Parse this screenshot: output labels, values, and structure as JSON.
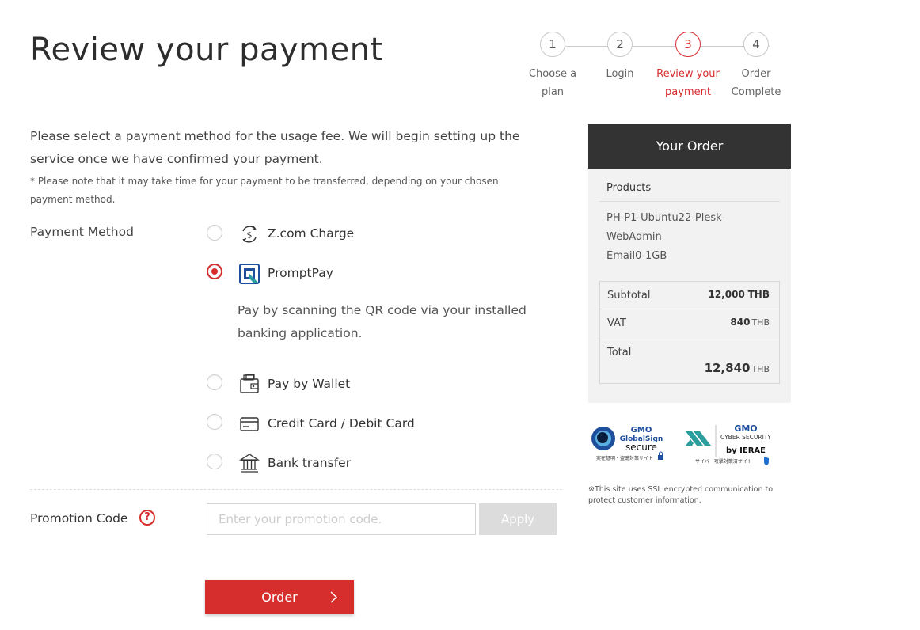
{
  "page": {
    "title": "Review your payment"
  },
  "stepper": {
    "steps": [
      {
        "number": "1",
        "label_line1": "Choose a",
        "label_line2": "plan"
      },
      {
        "number": "2",
        "label_line1": "Login",
        "label_line2": ""
      },
      {
        "number": "3",
        "label_line1": "Review your",
        "label_line2": "payment"
      },
      {
        "number": "4",
        "label_line1": "Order",
        "label_line2": "Complete"
      }
    ],
    "active_step": "3",
    "active_color": "#d62d2d"
  },
  "intro": {
    "text": "Please select a payment method for the usage fee. We will begin setting up the service once we have confirmed your payment.",
    "note": "* Please note that it may take time for your payment to be transferred, depending on your chosen payment method."
  },
  "payment": {
    "label": "Payment Method",
    "selected": "PromptPay",
    "methods": [
      {
        "name": "Z.com Charge",
        "icon": "zcom-charge-icon",
        "checked": false
      },
      {
        "name": "PromptPay",
        "icon": "promptpay-icon",
        "checked": true,
        "description": "Pay by scanning the QR code via your installed banking application."
      },
      {
        "name": "Pay by Wallet",
        "icon": "wallet-icon",
        "checked": false
      },
      {
        "name": "Credit Card / Debit Card",
        "icon": "credit-card-icon",
        "checked": false
      },
      {
        "name": "Bank transfer",
        "icon": "bank-icon",
        "checked": false
      }
    ]
  },
  "promotion": {
    "label": "Promotion Code",
    "help_glyph": "?",
    "value": "",
    "placeholder": "Enter your promotion code.",
    "apply_label": "Apply"
  },
  "order_button": {
    "label": "Order"
  },
  "order_summary": {
    "title": "Your Order",
    "products_label": "Products",
    "product_lines": [
      "PH-P1-Ubuntu22-Plesk-",
      "WebAdmin",
      "Email0-1GB"
    ],
    "subtotal_label": "Subtotal",
    "subtotal_value": "12,000",
    "vat_label": "VAT",
    "vat_value": "840",
    "total_label": "Total",
    "total_value": "12,840",
    "currency": "THB"
  },
  "badges": {
    "globalsign": {
      "line1": "GMO",
      "line2": "GlobalSign",
      "line3": "secure",
      "line4": "実在証明・盗聴対策サイト"
    },
    "cybersecurity": {
      "line1": "GMO",
      "line2": "CYBER SECURITY",
      "line3": "by IERAE",
      "line4": "サイバー攻撃対策済サイト"
    },
    "ssl_note": "※This site uses SSL encrypted communication to protect customer information."
  },
  "colors": {
    "accent": "#d62d2d",
    "dark_header": "#333333",
    "panel_bg": "#f2f2f2",
    "brand_blue": "#1f4e9c",
    "brand_teal": "#2a9d9d"
  }
}
